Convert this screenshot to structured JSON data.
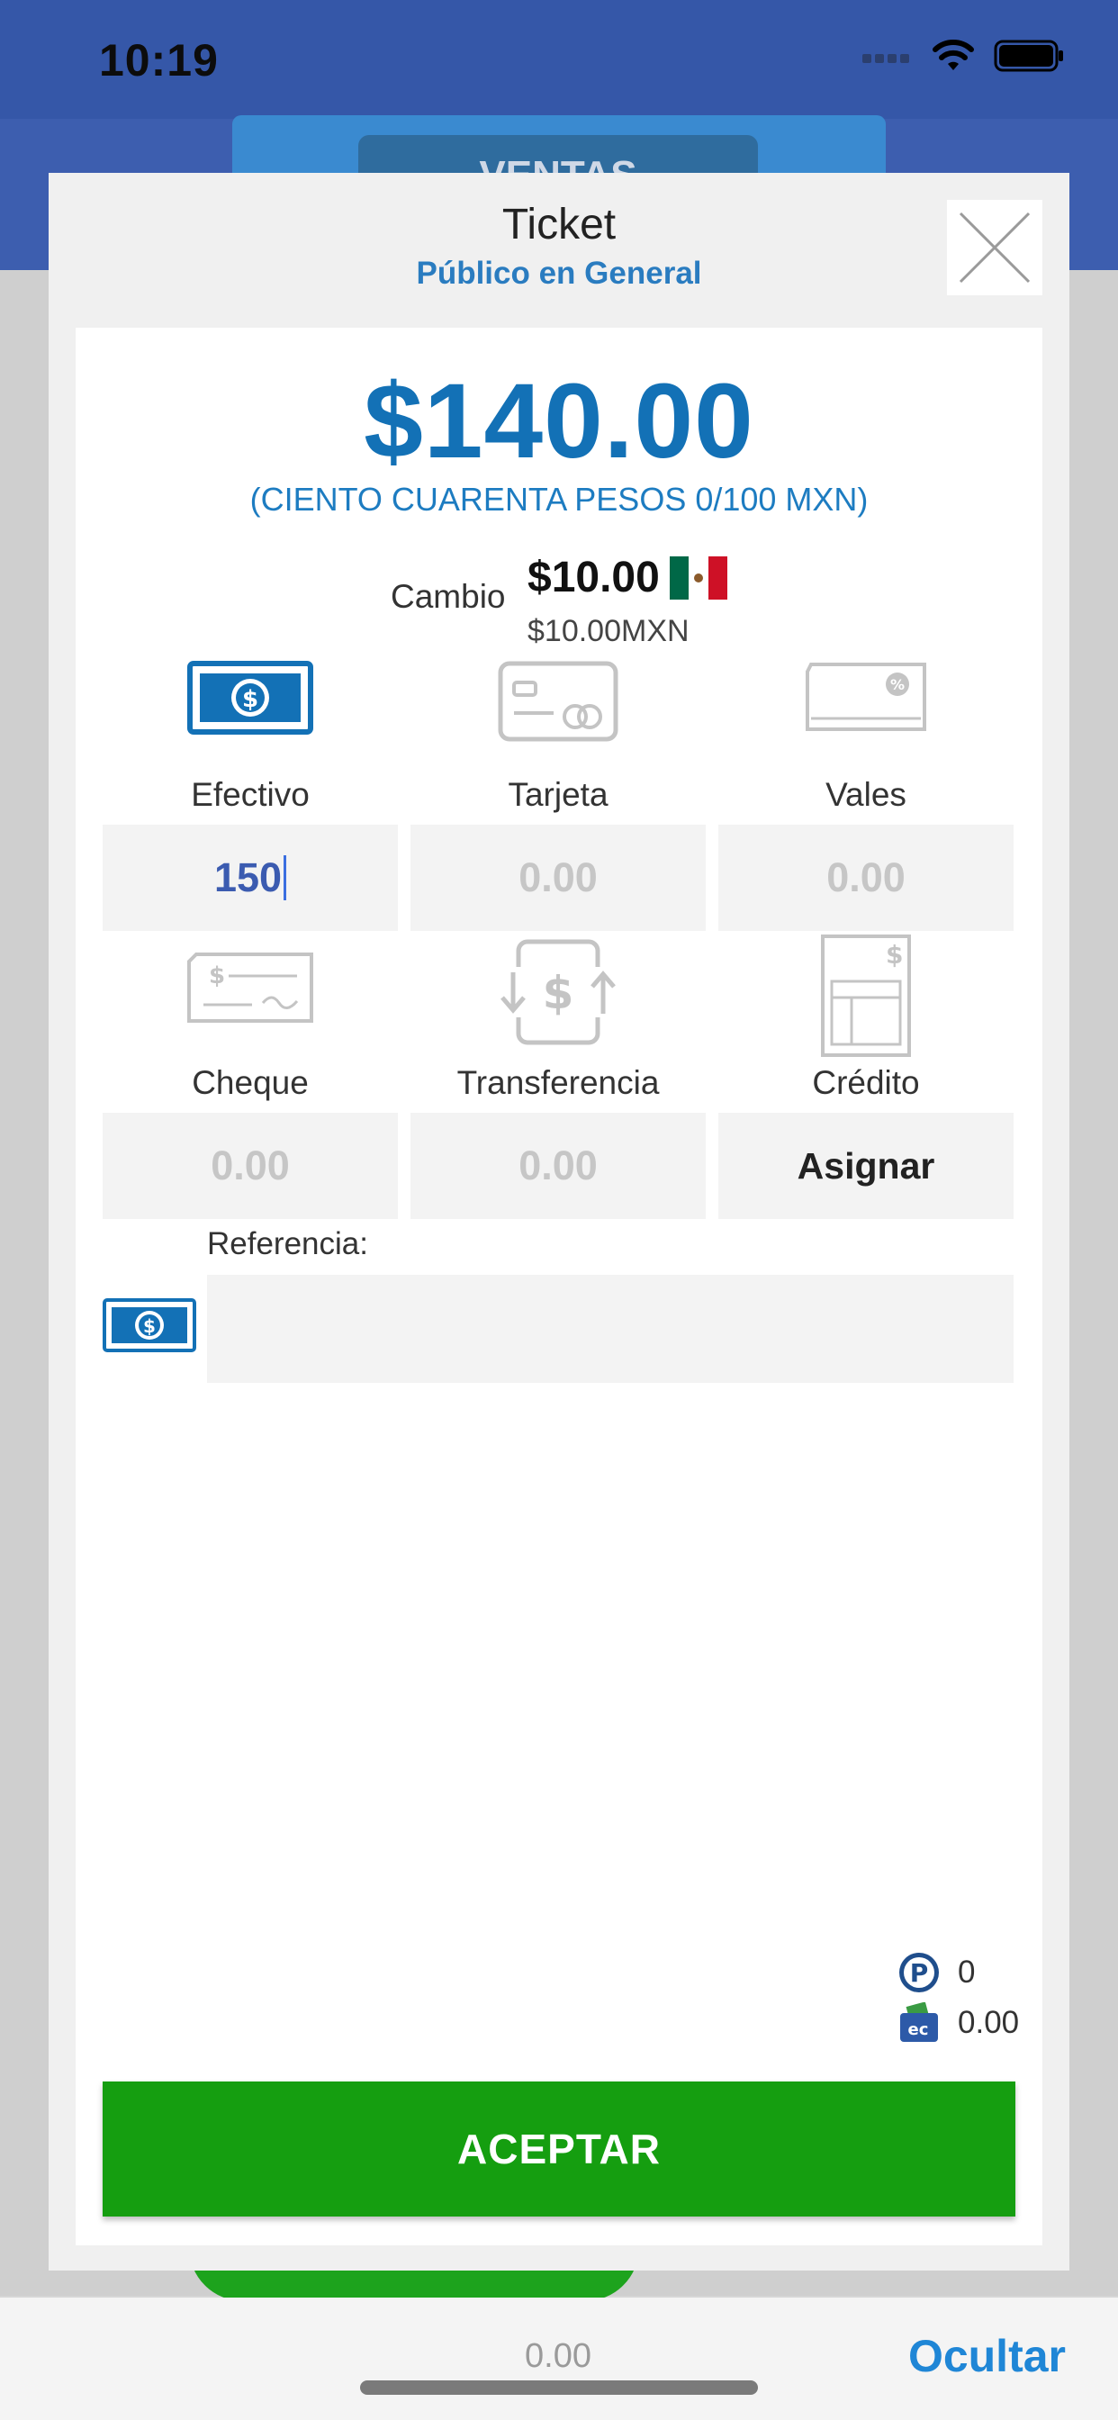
{
  "status_bar": {
    "time": "10:19"
  },
  "app_header": {
    "tab_label": "VENTAS"
  },
  "modal": {
    "title": "Ticket",
    "subtitle": "Público en General",
    "total": "$140.00",
    "total_words": "(CIENTO CUARENTA PESOS 0/100 MXN)",
    "cambio": {
      "label": "Cambio",
      "amount": "$10.00",
      "amount_mxn": "$10.00MXN"
    },
    "payment_methods": [
      {
        "label": "Efectivo",
        "value": "150",
        "icon": "cash-icon"
      },
      {
        "label": "Tarjeta",
        "value": "0.00",
        "icon": "card-icon"
      },
      {
        "label": "Vales",
        "value": "0.00",
        "icon": "voucher-icon"
      },
      {
        "label": "Cheque",
        "value": "0.00",
        "icon": "check-icon"
      },
      {
        "label": "Transferencia",
        "value": "0.00",
        "icon": "transfer-icon"
      },
      {
        "label": "Crédito",
        "value": "Asignar",
        "icon": "credit-icon"
      }
    ],
    "reference": {
      "label": "Referencia:",
      "value": ""
    },
    "points": "0",
    "wallet": "0.00",
    "accept_label": "ACEPTAR"
  },
  "bottom_bar": {
    "amount": "0.00",
    "hide_label": "Ocultar"
  },
  "colors": {
    "primary_blue": "#1371b6",
    "header_blue": "#3557a8",
    "accept_green": "#159e10"
  }
}
